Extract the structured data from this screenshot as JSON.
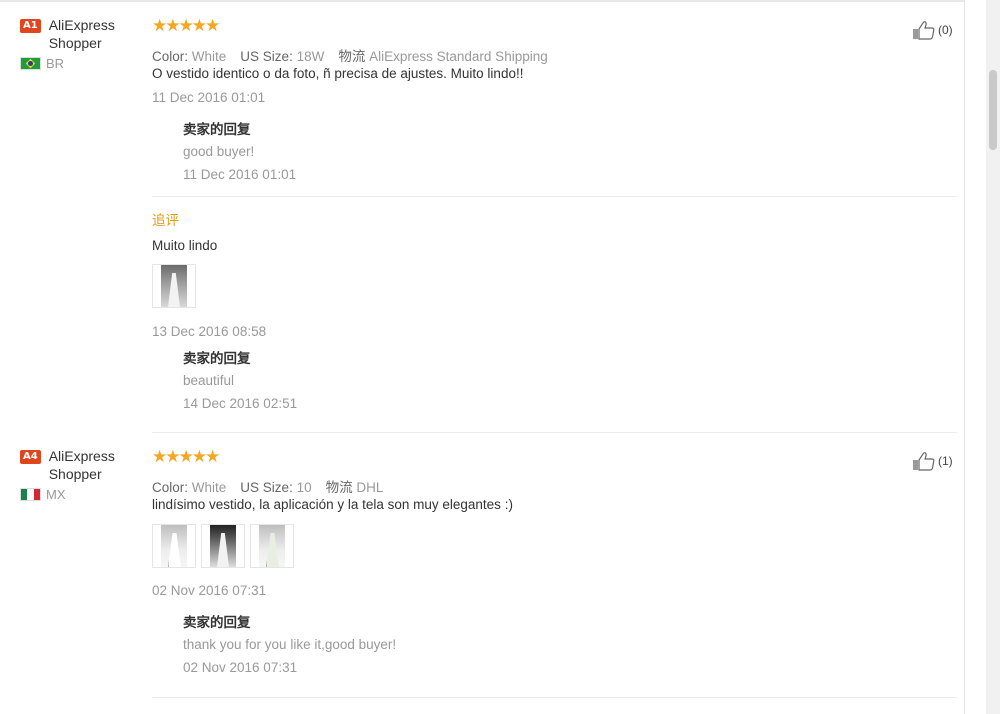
{
  "reviews": [
    {
      "user": {
        "badge": "A1",
        "name": "AliExpress Shopper",
        "country": "BR"
      },
      "rating": "★★★★★",
      "attrs": {
        "color_label": "Color:",
        "color": "White",
        "size_label": "US Size:",
        "size": "18W",
        "shipping_label": "物流",
        "shipping": "AliExpress Standard Shipping"
      },
      "text": "O vestido identico o da foto, ñ precisa de ajustes. Muito lindo!!",
      "date": "11 Dec 2016 01:01",
      "reply": {
        "title": "卖家的回复",
        "text": "good buyer!",
        "date": "11 Dec 2016 01:01"
      },
      "followup": {
        "label": "追评",
        "text": "Muito lindo",
        "date": "13 Dec 2016 08:58",
        "reply": {
          "title": "卖家的回复",
          "text": "beautiful",
          "date": "14 Dec 2016 02:51"
        }
      },
      "helpful": "(0)"
    },
    {
      "user": {
        "badge": "A4",
        "name": "AliExpress Shopper",
        "country": "MX"
      },
      "rating": "★★★★★",
      "attrs": {
        "color_label": "Color:",
        "color": "White",
        "size_label": "US Size:",
        "size": "10",
        "shipping_label": "物流",
        "shipping": "DHL"
      },
      "text": "lindísimo vestido, la aplicación y la tela son muy elegantes :)",
      "date": "02 Nov 2016 07:31",
      "reply": {
        "title": "卖家的回复",
        "text": "thank you for you like it,good buyer!",
        "date": "02 Nov 2016 07:31"
      },
      "helpful": "(1)"
    }
  ],
  "colors": {
    "badge": "#e0461d",
    "star": "#f5a623",
    "followup": "#e59a1a",
    "muted": "#999999"
  }
}
